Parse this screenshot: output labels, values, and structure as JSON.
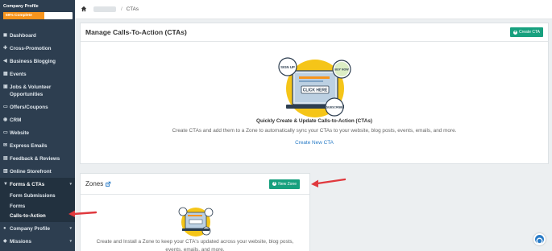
{
  "sidebar": {
    "profile_title": "Company Profile",
    "progress_label": "59% Complete",
    "progress_fraction": 0.59,
    "items": [
      {
        "label": "Dashboard",
        "icon": "dashboard-icon"
      },
      {
        "label": "Cross-Promotion",
        "icon": "cross-promotion-icon"
      },
      {
        "label": "Business Blogging",
        "icon": "megaphone-icon"
      },
      {
        "label": "Events",
        "icon": "calendar-icon"
      },
      {
        "label": "Jobs & Volunteer Opportunities",
        "icon": "briefcase-icon"
      },
      {
        "label": "Offers/Coupons",
        "icon": "folder-icon"
      },
      {
        "label": "CRM",
        "icon": "crm-icon"
      },
      {
        "label": "Website",
        "icon": "monitor-icon"
      },
      {
        "label": "Express Emails",
        "icon": "email-icon"
      },
      {
        "label": "Feedback & Reviews",
        "icon": "feedback-icon"
      },
      {
        "label": "Online Storefront",
        "icon": "storefront-icon"
      }
    ],
    "active_item": {
      "label": "Forms & CTAs",
      "icon": "filter-icon"
    },
    "sub_items": [
      "Form Submissions",
      "Forms",
      "Calls-to-Action"
    ],
    "bottom_items": [
      {
        "label": "Company Profile",
        "icon": "map-pin-icon"
      },
      {
        "label": "Missions",
        "icon": "missions-icon"
      }
    ]
  },
  "breadcrumb": {
    "current": "CTAs",
    "separator": "/"
  },
  "manage_panel": {
    "title": "Manage Calls-To-Action (CTAs)",
    "create_button": "Create CTA",
    "illustration": {
      "sign_up": "SIGN UP",
      "buy_now": "BUY NOW",
      "click_here": "CLICK HERE",
      "subscribe": "SUBSCRIBE"
    },
    "heading": "Quickly Create & Update Calls-to-Action (CTAs)",
    "description": "Create CTAs and add them to a Zone to automatically sync your CTAs to your website, blog posts, events, emails, and more.",
    "link": "Create New CTA"
  },
  "zones_panel": {
    "title": "Zones",
    "new_zone_button": "New Zone",
    "description": "Create and Install a Zone to keep your CTA's updated across your website, blog posts, events, emails, and more."
  },
  "colors": {
    "sidebar": "#2d3e50",
    "accent_green": "#17a07e",
    "progress_orange": "#f7941d",
    "link_blue": "#2a7cc7",
    "arrow_red": "#e0393e"
  }
}
